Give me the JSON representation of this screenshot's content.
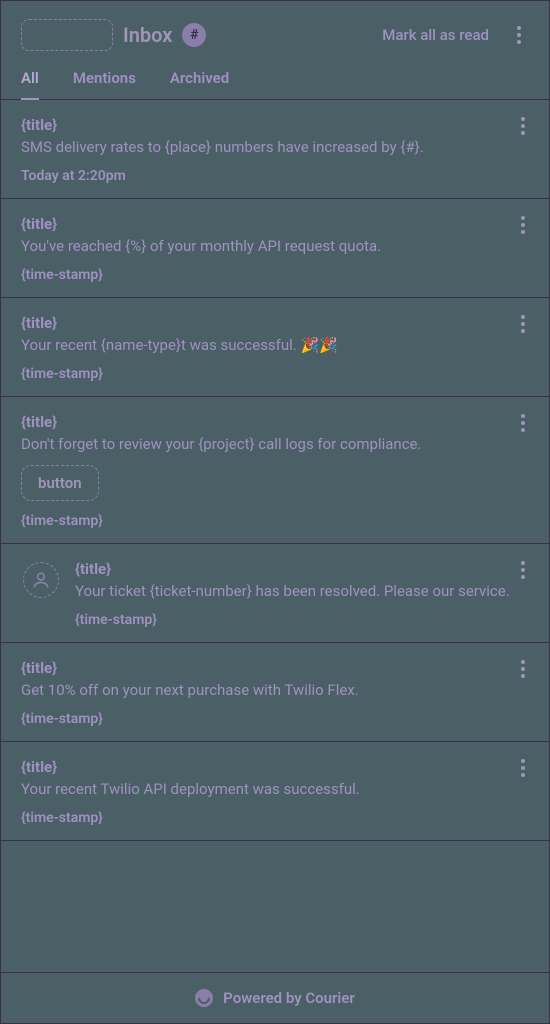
{
  "header": {
    "title": "Inbox",
    "count": "#",
    "mark_read": "Mark all as read"
  },
  "tabs": [
    {
      "label": "All",
      "active": true
    },
    {
      "label": "Mentions",
      "active": false
    },
    {
      "label": "Archived",
      "active": false
    }
  ],
  "items": [
    {
      "title": "{title}",
      "text": "SMS delivery rates to {place} numbers have increased by {#}.",
      "time": "Today at 2:20pm",
      "avatar": false,
      "button": null
    },
    {
      "title": "{title}",
      "text": "You've reached {%} of your monthly API request quota.",
      "time": "{time-stamp}",
      "avatar": false,
      "button": null
    },
    {
      "title": "{title}",
      "text": "Your recent {name-type}t was successful. 🎉🎉",
      "time": "{time-stamp}",
      "avatar": false,
      "button": null
    },
    {
      "title": "{title}",
      "text": "Don't forget to review your {project} call logs for compliance.",
      "time": "{time-stamp}",
      "avatar": false,
      "button": "button"
    },
    {
      "title": "{title}",
      "text": "Your ticket {ticket-number} has been resolved. Please our service.",
      "time": "{time-stamp}",
      "avatar": true,
      "button": null
    },
    {
      "title": "{title}",
      "text": "Get 10% off on your next purchase with Twilio Flex.",
      "time": "{time-stamp}",
      "avatar": false,
      "button": null
    },
    {
      "title": "{title}",
      "text": "Your recent Twilio API deployment was successful.",
      "time": "{time-stamp}",
      "avatar": false,
      "button": null
    }
  ],
  "footer": {
    "label": "Powered by Courier"
  }
}
